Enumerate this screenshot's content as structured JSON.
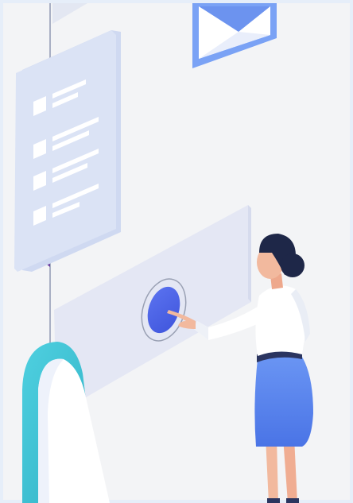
{
  "scene": {
    "background_color": "#f3f4f6",
    "frame_color": "#e6eef9",
    "accent_color": "#4f63e8",
    "panel_color": "#dfe5f4",
    "teal_color": "#41c4d6",
    "skirt_color": "#5f8cf0"
  },
  "illustration": {
    "checklist_items": 4,
    "icons": [
      "envelope-icon",
      "checkbox-icon",
      "touch-button-icon"
    ],
    "figure": "woman-pressing-button"
  }
}
